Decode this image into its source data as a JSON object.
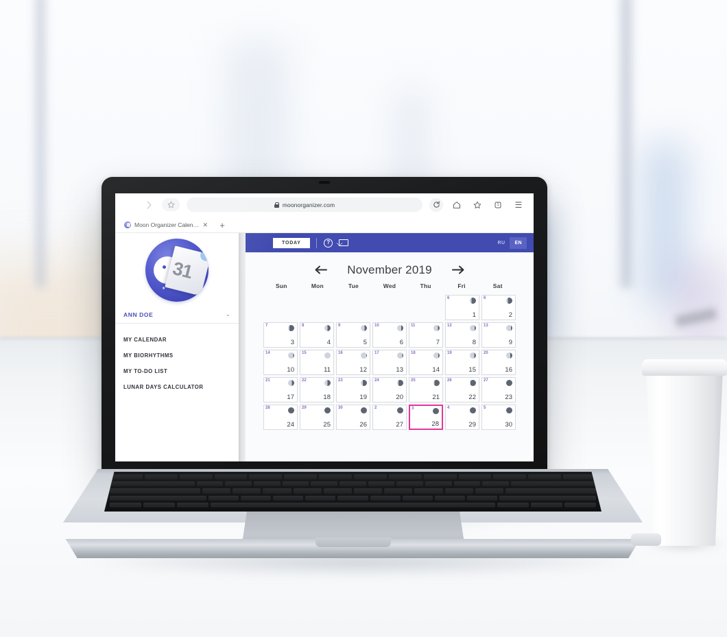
{
  "browser": {
    "url": "moonorganizer.com",
    "back_icon": "back-arrow-icon",
    "forward_icon": "forward-arrow-icon",
    "star_pill_icon": "★",
    "lock_icon": "lock-icon",
    "reload_icon": "⟳",
    "home_icon": "⌂",
    "bookmark_icon": "☆",
    "tabs_count_icon": "1",
    "menu_icon": "☰",
    "tab_title": "Moon Organizer Calend...",
    "tab_close": "✕",
    "new_tab": "+"
  },
  "sidebar": {
    "logo_day_number": "31",
    "user_name": "ANN DOE",
    "chevron": "⌄",
    "items": [
      {
        "label": "MY CALENDAR"
      },
      {
        "label": "MY BIORHYTHMS"
      },
      {
        "label": "MY TO-DO LIST"
      },
      {
        "label": "LUNAR DAYS CALCULATOR"
      }
    ]
  },
  "navbar": {
    "today_label": "TODAY",
    "help_icon": "?",
    "mail_icon": "mail-icon",
    "lang_ru": "RU",
    "lang_en": "EN",
    "active_lang": "EN",
    "bg_color": "#414bb0",
    "active_lang_bg": "#5a63c2"
  },
  "calendar": {
    "prev_arrow": "←",
    "next_arrow": "→",
    "month_title": "November 2019",
    "weekdays": [
      "Sun",
      "Mon",
      "Tue",
      "Wed",
      "Thu",
      "Fri",
      "Sat"
    ],
    "today_date": 28,
    "today_border_color": "#e5359b",
    "lunar_color": "#8b6bc6",
    "cells": [
      {
        "empty": true
      },
      {
        "empty": true
      },
      {
        "empty": true
      },
      {
        "empty": true
      },
      {
        "empty": true
      },
      {
        "day": 1,
        "lunar": 6,
        "phase": 0.72
      },
      {
        "day": 2,
        "lunar": 6,
        "phase": 0.75
      },
      {
        "day": 3,
        "lunar": 7,
        "phase": 0.8
      },
      {
        "day": 4,
        "lunar": 8,
        "phase": 0.5
      },
      {
        "day": 5,
        "lunar": 9,
        "phase": 0.38
      },
      {
        "day": 6,
        "lunar": 10,
        "phase": 0.32
      },
      {
        "day": 7,
        "lunar": 11,
        "phase": 0.28
      },
      {
        "day": 8,
        "lunar": 12,
        "phase": 0.24
      },
      {
        "day": 9,
        "lunar": 13,
        "phase": 0.2
      },
      {
        "day": 10,
        "lunar": 14,
        "phase": 0.14
      },
      {
        "day": 11,
        "lunar": 15,
        "phase": 0.06
      },
      {
        "day": 12,
        "lunar": 16,
        "phase": 0.1
      },
      {
        "day": 13,
        "lunar": 17,
        "phase": 0.16
      },
      {
        "day": 14,
        "lunar": 18,
        "phase": 0.22
      },
      {
        "day": 15,
        "lunar": 19,
        "phase": 0.28
      },
      {
        "day": 16,
        "lunar": 20,
        "phase": 0.34
      },
      {
        "day": 17,
        "lunar": 21,
        "phase": 0.4
      },
      {
        "day": 18,
        "lunar": 22,
        "phase": 0.5
      },
      {
        "day": 19,
        "lunar": 23,
        "phase": 0.68
      },
      {
        "day": 20,
        "lunar": 24,
        "phase": 0.76
      },
      {
        "day": 21,
        "lunar": 25,
        "phase": 0.84
      },
      {
        "day": 22,
        "lunar": 26,
        "phase": 0.9
      },
      {
        "day": 23,
        "lunar": 27,
        "phase": 0.95
      },
      {
        "day": 24,
        "lunar": 28,
        "phase": 1.0
      },
      {
        "day": 25,
        "lunar": 29,
        "phase": 1.0
      },
      {
        "day": 26,
        "lunar": 30,
        "phase": 1.0
      },
      {
        "day": 27,
        "lunar": 2,
        "phase": 1.0
      },
      {
        "day": 28,
        "lunar": 3,
        "phase": 1.0,
        "today": true
      },
      {
        "day": 29,
        "lunar": 4,
        "phase": 1.0
      },
      {
        "day": 30,
        "lunar": 5,
        "phase": 1.0
      }
    ]
  }
}
